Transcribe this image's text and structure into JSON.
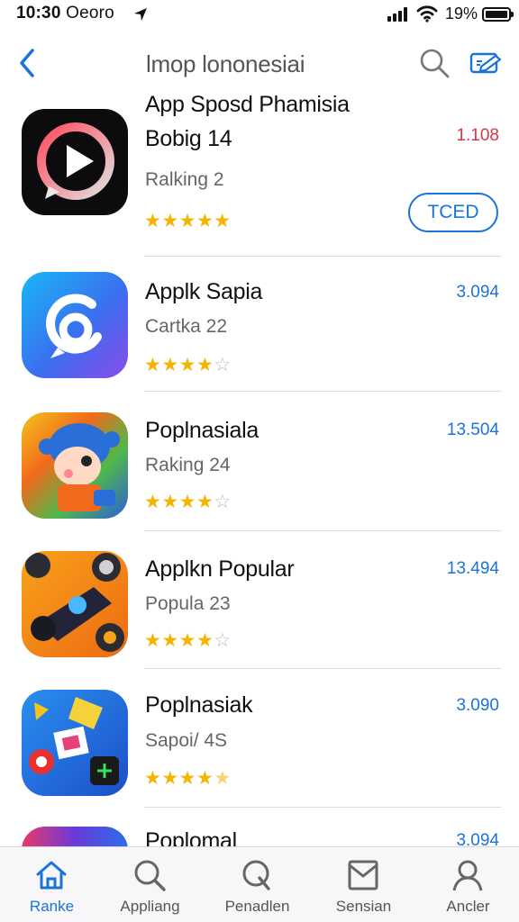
{
  "status_bar": {
    "time": "10:30",
    "carrier": "Oeoro",
    "battery": "19%",
    "battery_level": 0.19
  },
  "header": {
    "title": "lmop lononesiai",
    "back_icon": "chevron-left-icon",
    "search_icon": "search-icon",
    "edit_icon": "edit-icon"
  },
  "apps": [
    {
      "name_line1": "App Sposd Phamisia",
      "name_line2": "Bobig 14",
      "subtitle": "Ralking 2",
      "price": "1.108",
      "rating": 5,
      "button": "TCED",
      "icon": "play-chat-icon"
    },
    {
      "name": "Applk Sapia",
      "subtitle": "Cartka 22",
      "price": "3.094",
      "rating": 4,
      "icon": "chat-swirl-icon"
    },
    {
      "name": "Poplnasiala",
      "subtitle": "Raking 24",
      "price": "13.504",
      "rating": 4,
      "icon": "cartoon-character-icon"
    },
    {
      "name": "Applkn Popular",
      "subtitle": "Popula 23",
      "price": "13.494",
      "rating": 4,
      "icon": "race-car-icon"
    },
    {
      "name": "Poplnasiak",
      "subtitle": "Sapoi/ 4S",
      "price": "3.090",
      "rating": 4.5,
      "icon": "game-collage-icon"
    },
    {
      "name": "Poplomal",
      "price": "3.094",
      "icon": "partial-app-icon"
    }
  ],
  "tabs": [
    {
      "label": "Ranke",
      "icon": "home-icon",
      "active": true
    },
    {
      "label": "Appliang",
      "icon": "search-icon",
      "active": false
    },
    {
      "label": "Penadlen",
      "icon": "search-icon",
      "active": false
    },
    {
      "label": "Sensian",
      "icon": "inbox-icon",
      "active": false
    },
    {
      "label": "Ancler",
      "icon": "person-icon",
      "active": false
    }
  ],
  "colors": {
    "accent": "#1a73d9",
    "price_red": "#d23a48",
    "star": "#f5b400"
  }
}
